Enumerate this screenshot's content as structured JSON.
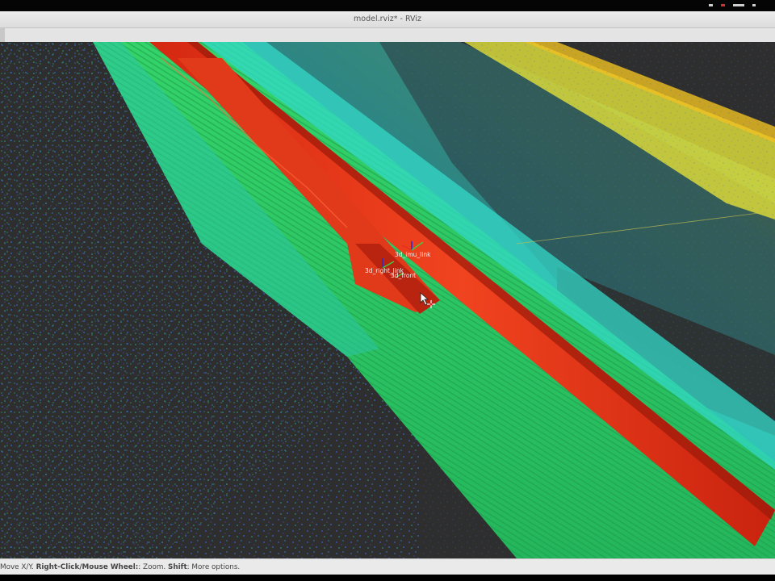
{
  "window": {
    "title": "model.rviz* - RViz"
  },
  "viewport": {
    "frame_labels": [
      "3d_imu_link",
      "3d_right_link",
      "3d_front"
    ],
    "colors": {
      "background": "#2e2e2f",
      "road_surface": "#2fd06a",
      "curb_band": "#2fe0d0",
      "roadside_high": "#e8e030",
      "path_marker": "#e8341c"
    },
    "cursor_icons": [
      "mouse-pointer-icon",
      "move-crosshair-icon"
    ]
  },
  "status": {
    "prefix": "Move X/Y. ",
    "right_click": "Right-Click/Mouse Wheel:",
    "zoom": ": Zoom. ",
    "shift": "Shift",
    "more": ": More options."
  }
}
